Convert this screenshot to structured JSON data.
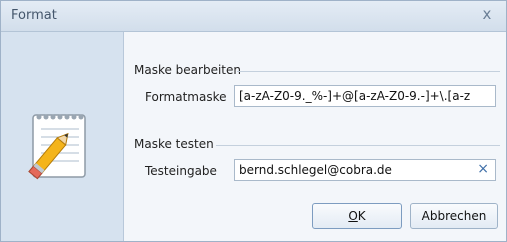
{
  "window": {
    "title": "Format",
    "close_glyph": "x"
  },
  "icon": {
    "name": "notepad-pencil-icon"
  },
  "mask_edit": {
    "group_label": "Maske bearbeiten",
    "field_label": "Formatmaske",
    "value": "[a-zA-Z0-9._%-]+@[a-zA-Z0-9.-]+\\.[a-z"
  },
  "mask_test": {
    "group_label": "Maske testen",
    "field_label": "Testeingabe",
    "value": "bernd.schlegel@cobra.de",
    "clear_glyph": "×"
  },
  "buttons": {
    "ok_mnemonic": "O",
    "ok_rest": "K",
    "cancel": "Abbrechen"
  },
  "colors": {
    "accent": "#3f6fa8",
    "title_text": "#44566c"
  }
}
